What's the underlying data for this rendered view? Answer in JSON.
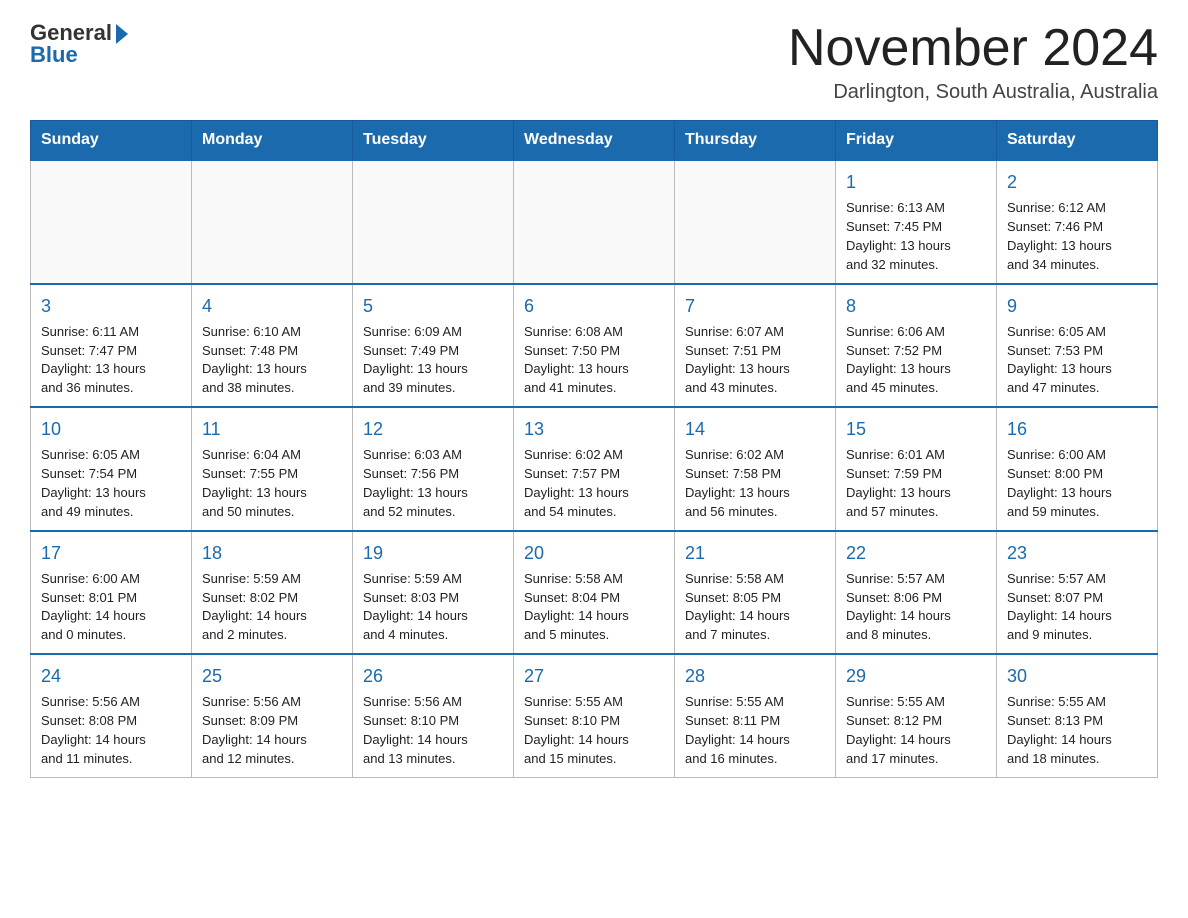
{
  "header": {
    "logo_general": "General",
    "logo_blue": "Blue",
    "month_title": "November 2024",
    "location": "Darlington, South Australia, Australia"
  },
  "days_of_week": [
    "Sunday",
    "Monday",
    "Tuesday",
    "Wednesday",
    "Thursday",
    "Friday",
    "Saturday"
  ],
  "weeks": [
    [
      {
        "day": null
      },
      {
        "day": null
      },
      {
        "day": null
      },
      {
        "day": null
      },
      {
        "day": null
      },
      {
        "day": "1",
        "sunrise": "6:13 AM",
        "sunset": "7:45 PM",
        "daylight": "13 hours and 32 minutes."
      },
      {
        "day": "2",
        "sunrise": "6:12 AM",
        "sunset": "7:46 PM",
        "daylight": "13 hours and 34 minutes."
      }
    ],
    [
      {
        "day": "3",
        "sunrise": "6:11 AM",
        "sunset": "7:47 PM",
        "daylight": "13 hours and 36 minutes."
      },
      {
        "day": "4",
        "sunrise": "6:10 AM",
        "sunset": "7:48 PM",
        "daylight": "13 hours and 38 minutes."
      },
      {
        "day": "5",
        "sunrise": "6:09 AM",
        "sunset": "7:49 PM",
        "daylight": "13 hours and 39 minutes."
      },
      {
        "day": "6",
        "sunrise": "6:08 AM",
        "sunset": "7:50 PM",
        "daylight": "13 hours and 41 minutes."
      },
      {
        "day": "7",
        "sunrise": "6:07 AM",
        "sunset": "7:51 PM",
        "daylight": "13 hours and 43 minutes."
      },
      {
        "day": "8",
        "sunrise": "6:06 AM",
        "sunset": "7:52 PM",
        "daylight": "13 hours and 45 minutes."
      },
      {
        "day": "9",
        "sunrise": "6:05 AM",
        "sunset": "7:53 PM",
        "daylight": "13 hours and 47 minutes."
      }
    ],
    [
      {
        "day": "10",
        "sunrise": "6:05 AM",
        "sunset": "7:54 PM",
        "daylight": "13 hours and 49 minutes."
      },
      {
        "day": "11",
        "sunrise": "6:04 AM",
        "sunset": "7:55 PM",
        "daylight": "13 hours and 50 minutes."
      },
      {
        "day": "12",
        "sunrise": "6:03 AM",
        "sunset": "7:56 PM",
        "daylight": "13 hours and 52 minutes."
      },
      {
        "day": "13",
        "sunrise": "6:02 AM",
        "sunset": "7:57 PM",
        "daylight": "13 hours and 54 minutes."
      },
      {
        "day": "14",
        "sunrise": "6:02 AM",
        "sunset": "7:58 PM",
        "daylight": "13 hours and 56 minutes."
      },
      {
        "day": "15",
        "sunrise": "6:01 AM",
        "sunset": "7:59 PM",
        "daylight": "13 hours and 57 minutes."
      },
      {
        "day": "16",
        "sunrise": "6:00 AM",
        "sunset": "8:00 PM",
        "daylight": "13 hours and 59 minutes."
      }
    ],
    [
      {
        "day": "17",
        "sunrise": "6:00 AM",
        "sunset": "8:01 PM",
        "daylight": "14 hours and 0 minutes."
      },
      {
        "day": "18",
        "sunrise": "5:59 AM",
        "sunset": "8:02 PM",
        "daylight": "14 hours and 2 minutes."
      },
      {
        "day": "19",
        "sunrise": "5:59 AM",
        "sunset": "8:03 PM",
        "daylight": "14 hours and 4 minutes."
      },
      {
        "day": "20",
        "sunrise": "5:58 AM",
        "sunset": "8:04 PM",
        "daylight": "14 hours and 5 minutes."
      },
      {
        "day": "21",
        "sunrise": "5:58 AM",
        "sunset": "8:05 PM",
        "daylight": "14 hours and 7 minutes."
      },
      {
        "day": "22",
        "sunrise": "5:57 AM",
        "sunset": "8:06 PM",
        "daylight": "14 hours and 8 minutes."
      },
      {
        "day": "23",
        "sunrise": "5:57 AM",
        "sunset": "8:07 PM",
        "daylight": "14 hours and 9 minutes."
      }
    ],
    [
      {
        "day": "24",
        "sunrise": "5:56 AM",
        "sunset": "8:08 PM",
        "daylight": "14 hours and 11 minutes."
      },
      {
        "day": "25",
        "sunrise": "5:56 AM",
        "sunset": "8:09 PM",
        "daylight": "14 hours and 12 minutes."
      },
      {
        "day": "26",
        "sunrise": "5:56 AM",
        "sunset": "8:10 PM",
        "daylight": "14 hours and 13 minutes."
      },
      {
        "day": "27",
        "sunrise": "5:55 AM",
        "sunset": "8:10 PM",
        "daylight": "14 hours and 15 minutes."
      },
      {
        "day": "28",
        "sunrise": "5:55 AM",
        "sunset": "8:11 PM",
        "daylight": "14 hours and 16 minutes."
      },
      {
        "day": "29",
        "sunrise": "5:55 AM",
        "sunset": "8:12 PM",
        "daylight": "14 hours and 17 minutes."
      },
      {
        "day": "30",
        "sunrise": "5:55 AM",
        "sunset": "8:13 PM",
        "daylight": "14 hours and 18 minutes."
      }
    ]
  ],
  "labels": {
    "sunrise": "Sunrise:",
    "sunset": "Sunset:",
    "daylight": "Daylight:"
  }
}
